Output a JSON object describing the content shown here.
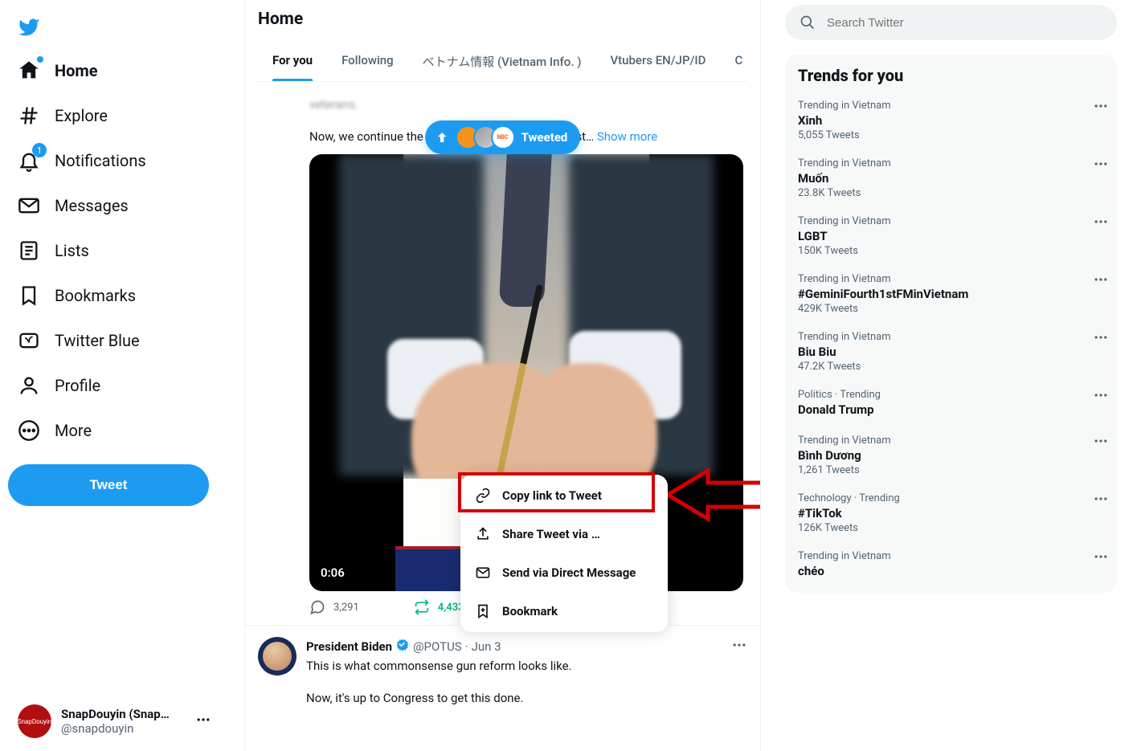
{
  "sidebar": {
    "items": {
      "home": "Home",
      "explore": "Explore",
      "notifications": "Notifications",
      "messages": "Messages",
      "lists": "Lists",
      "bookmarks": "Bookmarks",
      "twitter_blue": "Twitter Blue",
      "profile": "Profile",
      "more": "More"
    },
    "notifications_badge": "1",
    "tweet_button": "Tweet",
    "account": {
      "name": "SnapDouyin (Snap…",
      "handle": "@snapdouyin"
    }
  },
  "header": {
    "title": "Home"
  },
  "tabs": {
    "for_you": "For you",
    "following": "Following",
    "vietnam_info": "ベトナム情報 (Vietnam Info. )",
    "vtubers": "Vtubers EN/JP/ID",
    "truncated": "C"
  },
  "tweeted_pill": {
    "label": "Tweeted"
  },
  "tweet1": {
    "text_line1_trail": "",
    "text_line2": "Now, we continue the work of building the strongest… ",
    "show_more": "Show more",
    "video_time": "0:06",
    "replies": "3,291",
    "retweets": "4,433"
  },
  "share_menu": {
    "copy_link": "Copy link to Tweet",
    "share_via": "Share Tweet via …",
    "send_dm": "Send via Direct Message",
    "bookmark": "Bookmark"
  },
  "tweet2": {
    "name": "President Biden",
    "handle": "@POTUS",
    "dot": "·",
    "date": "Jun 3",
    "line1": "This is what commonsense gun reform looks like.",
    "line2": "Now, it's up to Congress to get this done."
  },
  "search": {
    "placeholder": "Search Twitter"
  },
  "trends_title": "Trends for you",
  "trends": [
    {
      "ctx": "Trending in Vietnam",
      "topic": "Xinh",
      "cnt": "5,055 Tweets"
    },
    {
      "ctx": "Trending in Vietnam",
      "topic": "Muốn",
      "cnt": "23.8K Tweets"
    },
    {
      "ctx": "Trending in Vietnam",
      "topic": "LGBT",
      "cnt": "150K Tweets"
    },
    {
      "ctx": "Trending in Vietnam",
      "topic": "#GeminiFourth1stFMinVietnam",
      "cnt": "429K Tweets"
    },
    {
      "ctx": "Trending in Vietnam",
      "topic": "Biu Biu",
      "cnt": "47.2K Tweets"
    },
    {
      "ctx": "Politics · Trending",
      "topic": "Donald Trump",
      "cnt": ""
    },
    {
      "ctx": "Trending in Vietnam",
      "topic": "Bình Dương",
      "cnt": "1,261 Tweets"
    },
    {
      "ctx": "Technology · Trending",
      "topic": "#TikTok",
      "cnt": "126K Tweets"
    },
    {
      "ctx": "Trending in Vietnam",
      "topic": "chéo",
      "cnt": ""
    }
  ]
}
